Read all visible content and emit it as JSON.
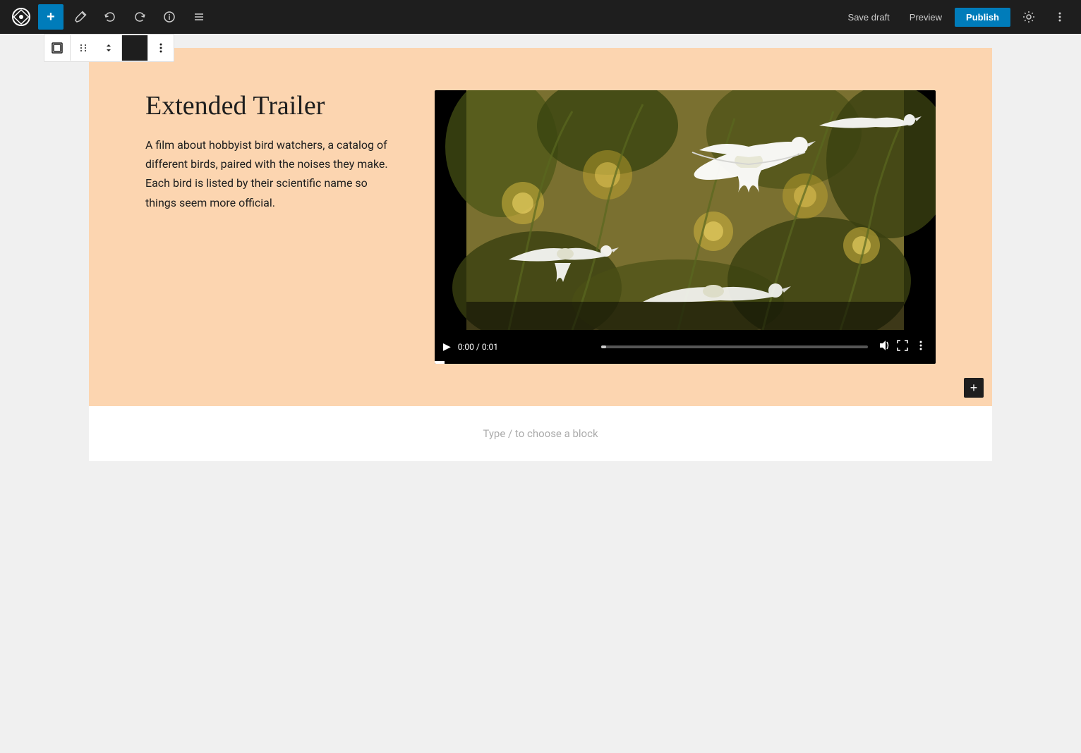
{
  "topbar": {
    "add_label": "+",
    "save_draft_label": "Save draft",
    "preview_label": "Preview",
    "publish_label": "Publish",
    "wp_logo": "W"
  },
  "block_toolbar": {
    "parent_btn": "⊞",
    "drag_btn": "⠿",
    "move_btn": "⌄",
    "style_btn": "■",
    "more_btn": "⋮"
  },
  "media_text": {
    "title": "Extended Trailer",
    "description": "A film about hobbyist bird watchers, a catalog of different birds, paired with the noises they make. Each bird is listed by their scientific name so things seem more official.",
    "background_color": "#fcd5b0",
    "video_time": "0:00 / 0:01"
  },
  "placeholder": {
    "text": "Type / to choose a block"
  }
}
